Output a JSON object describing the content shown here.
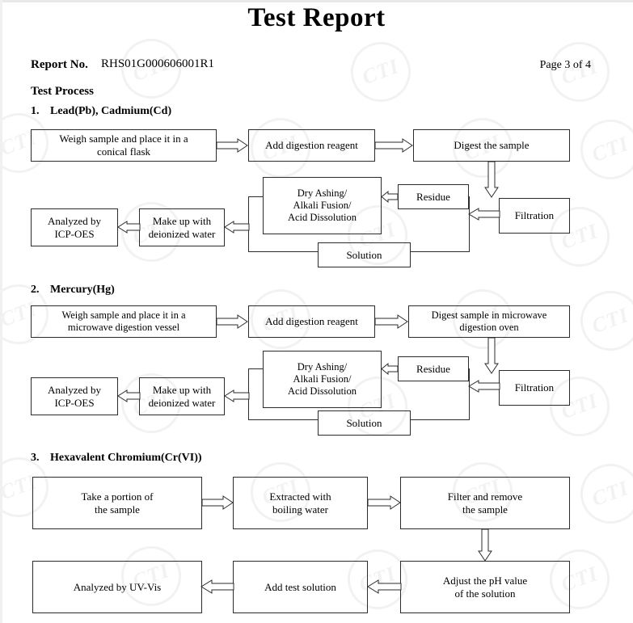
{
  "document": {
    "title": "Test Report",
    "report_no_label": "Report No.",
    "report_no_value": "RHS01G000606001R1",
    "page_indicator": "Page 3 of 4",
    "process_heading": "Test Process",
    "watermark_text": "CTI"
  },
  "sections": [
    {
      "number": "1.",
      "heading": "Lead(Pb), Cadmium(Cd)",
      "boxes": {
        "weigh": "Weigh sample and place it in a\nconical flask",
        "reagent": "Add digestion reagent",
        "digest": "Digest the sample",
        "dry_ashing": "Dry Ashing/\nAlkali Fusion/\nAcid Dissolution",
        "residue": "Residue",
        "filtration": "Filtration",
        "solution": "Solution",
        "make_up": "Make up with\ndeionized water",
        "analyzed": "Analyzed by\nICP-OES"
      }
    },
    {
      "number": "2.",
      "heading": "Mercury(Hg)",
      "boxes": {
        "weigh": "Weigh sample and place it in a\nmicrowave digestion vessel",
        "reagent": "Add digestion reagent",
        "digest": "Digest sample in microwave\ndigestion oven",
        "dry_ashing": "Dry Ashing/\nAlkali Fusion/\nAcid Dissolution",
        "residue": "Residue",
        "filtration": "Filtration",
        "solution": "Solution",
        "make_up": "Make up with\ndeionized water",
        "analyzed": "Analyzed by\nICP-OES"
      }
    },
    {
      "number": "3.",
      "heading": "Hexavalent Chromium(Cr(VI))",
      "boxes": {
        "take_portion": "Take a portion of\nthe sample",
        "extracted": "Extracted with\nboiling water",
        "filter": "Filter and remove\nthe sample",
        "adjust_ph": "Adjust the pH value\nof the solution",
        "add_test": "Add test solution",
        "analyzed": "Analyzed by UV-Vis"
      }
    }
  ],
  "colors": {
    "text": "#000000",
    "box_border": "#2b2b2b",
    "watermark": "#f2f2f2",
    "page_background": "#ffffff"
  }
}
